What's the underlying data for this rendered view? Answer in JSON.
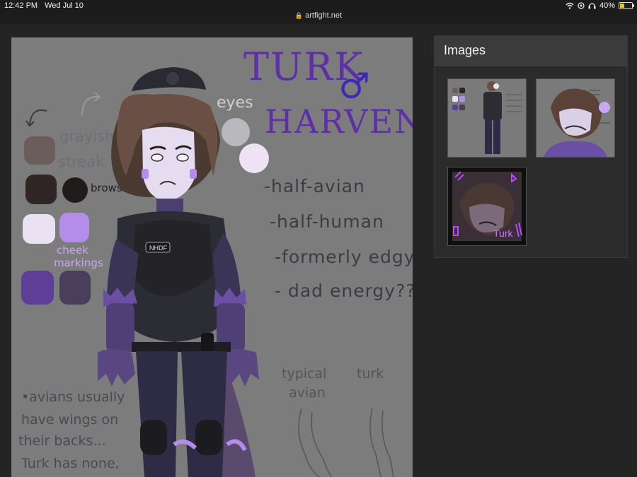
{
  "status_bar": {
    "time": "12:42 PM",
    "date": "Wed Jul 10",
    "url": "artfight.net",
    "battery": "40%",
    "battery_level": 0.4
  },
  "artwork": {
    "title_line1": "TURK",
    "title_line2": "HARVEN",
    "gender_symbol": "♂",
    "eyes_label": "eyes",
    "hair_label_1": "grayish",
    "hair_label_2": "streak",
    "brows_label": "brows",
    "cheek_label_1": "cheek",
    "cheek_label_2": "markings",
    "traits": [
      "-half-avian",
      "-half-human",
      "-formerly edgy",
      "- dad energy??"
    ],
    "note_lines": [
      "•avians usually",
      "have wings on",
      "their backs...",
      "Turk has none,"
    ],
    "label_typical": "typical",
    "label_avian": "avian",
    "label_turk": "turk",
    "badge": "NHDF",
    "swatch_colors": [
      "#6b5e5a",
      "#2f2524",
      "#221b1b",
      "#eae1f2",
      "#b48ce9",
      "#5d3f98",
      "#4a3f5a"
    ]
  },
  "images_panel": {
    "title": "Images",
    "thumb_labels": [
      "Turk"
    ]
  }
}
